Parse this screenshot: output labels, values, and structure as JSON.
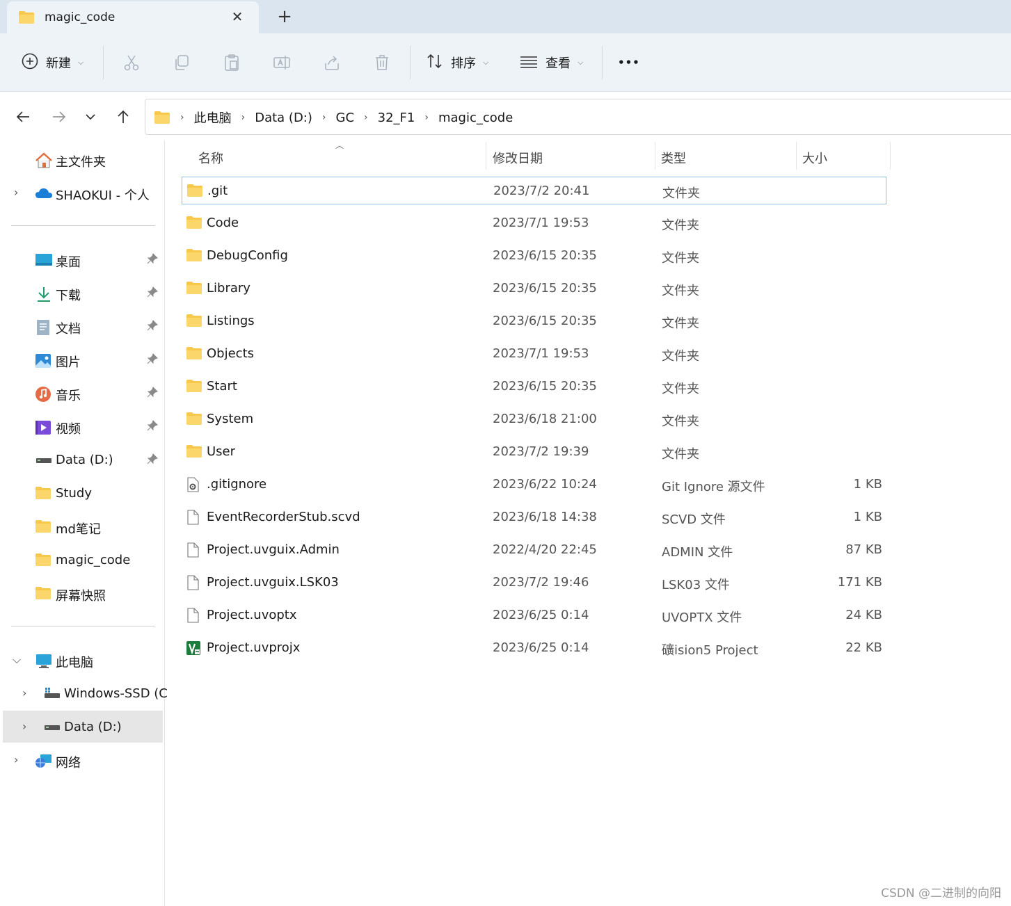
{
  "tab": {
    "title": "magic_code",
    "close": "✕",
    "new_tab": "+"
  },
  "toolbar": {
    "new_label": "新建",
    "sort_label": "排序",
    "view_label": "查看",
    "more": "•••"
  },
  "breadcrumb": [
    "此电脑",
    "Data (D:)",
    "GC",
    "32_F1",
    "magic_code"
  ],
  "sidebar": {
    "home": "主文件夹",
    "onedrive": "SHAOKUI - 个人",
    "quick": [
      {
        "label": "桌面",
        "icon": "desktop-icon"
      },
      {
        "label": "下载",
        "icon": "download-icon"
      },
      {
        "label": "文档",
        "icon": "document-icon"
      },
      {
        "label": "图片",
        "icon": "pictures-icon"
      },
      {
        "label": "音乐",
        "icon": "music-icon"
      },
      {
        "label": "视频",
        "icon": "video-icon"
      },
      {
        "label": "Data (D:)",
        "icon": "drive-icon"
      },
      {
        "label": "Study",
        "icon": "folder-icon"
      },
      {
        "label": "md笔记",
        "icon": "folder-icon"
      },
      {
        "label": "magic_code",
        "icon": "folder-icon"
      },
      {
        "label": "屏幕快照",
        "icon": "folder-icon"
      }
    ],
    "this_pc": "此电脑",
    "drives": [
      "Windows-SSD (C",
      "Data (D:)"
    ],
    "network": "网络"
  },
  "columns": {
    "name": "名称",
    "date": "修改日期",
    "type": "类型",
    "size": "大小"
  },
  "files": [
    {
      "name": ".git",
      "date": "2023/7/2 20:41",
      "type": "文件夹",
      "size": "",
      "kind": "folder"
    },
    {
      "name": "Code",
      "date": "2023/7/1 19:53",
      "type": "文件夹",
      "size": "",
      "kind": "folder"
    },
    {
      "name": "DebugConfig",
      "date": "2023/6/15 20:35",
      "type": "文件夹",
      "size": "",
      "kind": "folder"
    },
    {
      "name": "Library",
      "date": "2023/6/15 20:35",
      "type": "文件夹",
      "size": "",
      "kind": "folder"
    },
    {
      "name": "Listings",
      "date": "2023/6/15 20:35",
      "type": "文件夹",
      "size": "",
      "kind": "folder"
    },
    {
      "name": "Objects",
      "date": "2023/7/1 19:53",
      "type": "文件夹",
      "size": "",
      "kind": "folder"
    },
    {
      "name": "Start",
      "date": "2023/6/15 20:35",
      "type": "文件夹",
      "size": "",
      "kind": "folder"
    },
    {
      "name": "System",
      "date": "2023/6/18 21:00",
      "type": "文件夹",
      "size": "",
      "kind": "folder"
    },
    {
      "name": "User",
      "date": "2023/7/2 19:39",
      "type": "文件夹",
      "size": "",
      "kind": "folder"
    },
    {
      "name": ".gitignore",
      "date": "2023/6/22 10:24",
      "type": "Git Ignore 源文件",
      "size": "1 KB",
      "kind": "config"
    },
    {
      "name": "EventRecorderStub.scvd",
      "date": "2023/6/18 14:38",
      "type": "SCVD 文件",
      "size": "1 KB",
      "kind": "file"
    },
    {
      "name": "Project.uvguix.Admin",
      "date": "2022/4/20 22:45",
      "type": "ADMIN 文件",
      "size": "87 KB",
      "kind": "file"
    },
    {
      "name": "Project.uvguix.LSK03",
      "date": "2023/7/2 19:46",
      "type": "LSK03 文件",
      "size": "171 KB",
      "kind": "file"
    },
    {
      "name": "Project.uvoptx",
      "date": "2023/6/25 0:14",
      "type": "UVOPTX 文件",
      "size": "24 KB",
      "kind": "file"
    },
    {
      "name": "Project.uvprojx",
      "date": "2023/6/25 0:14",
      "type": "礦ision5 Project",
      "size": "22 KB",
      "kind": "keil"
    }
  ],
  "watermark": "CSDN @二进制的向阳",
  "colors": {
    "folder": "#f8c84a",
    "selection_border": "#8fbfe6",
    "accent": "#0067c0"
  }
}
